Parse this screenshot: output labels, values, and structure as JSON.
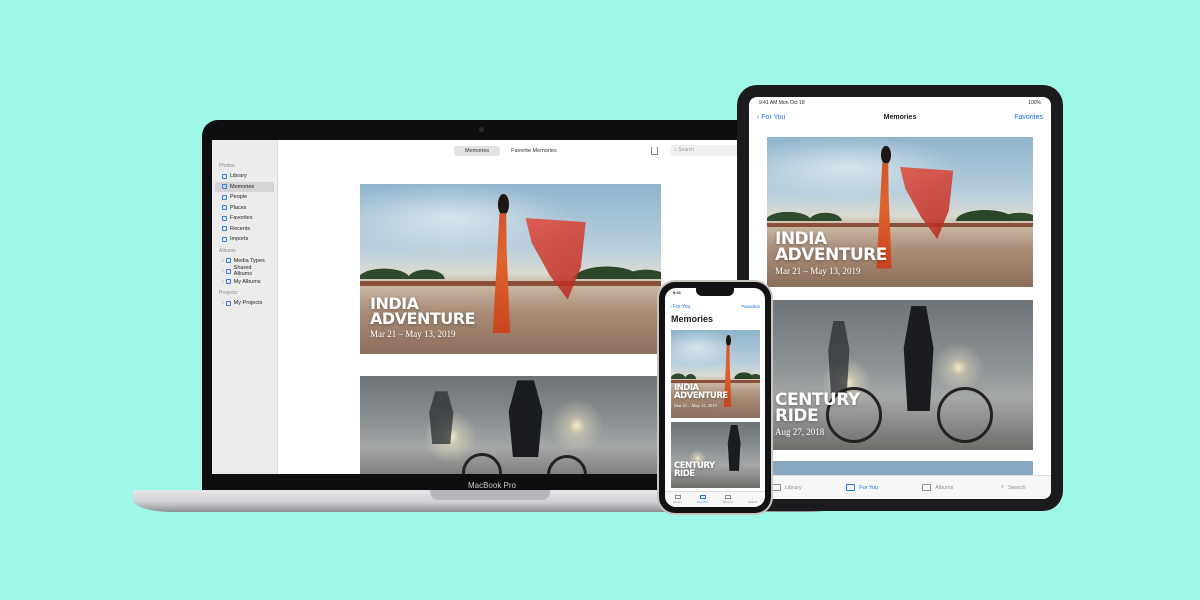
{
  "laptop": {
    "label": "MacBook Pro",
    "sidebar": {
      "sections": [
        {
          "title": "Photos",
          "items": [
            "Library",
            "Memories",
            "People",
            "Places",
            "Favorites",
            "Recents",
            "Imports"
          ]
        },
        {
          "title": "Albums",
          "items": [
            "Media Types",
            "Shared Albums",
            "My Albums"
          ]
        },
        {
          "title": "Projects",
          "items": [
            "My Projects"
          ]
        }
      ],
      "selected": "Memories"
    },
    "toolbar": {
      "tab_memories": "Memories",
      "tab_favorite_memories": "Favorite Memories",
      "search_placeholder": "Search"
    },
    "memories": [
      {
        "title_line1": "INDIA",
        "title_line2": "ADVENTURE",
        "date": "Mar 21 – May 13, 2019"
      }
    ]
  },
  "tablet": {
    "status": {
      "time": "9:41 AM",
      "date": "Mon Oct 18",
      "battery": "100%"
    },
    "nav": {
      "back": "For You",
      "title": "Memories",
      "right": "Favorites"
    },
    "memories": [
      {
        "title_line1": "INDIA",
        "title_line2": "ADVENTURE",
        "date": "Mar 21 – May 13, 2019"
      },
      {
        "title_line1": "CENTURY",
        "title_line2": "RIDE",
        "date": "Aug 27, 2018"
      }
    ],
    "tabs": [
      "Library",
      "For You",
      "Albums",
      "Search"
    ],
    "active_tab": "For You"
  },
  "phone": {
    "status": {
      "time": "9:41"
    },
    "nav": {
      "back": "For You",
      "right": "Favorites"
    },
    "title": "Memories",
    "memories": [
      {
        "title_line1": "INDIA",
        "title_line2": "ADVENTURE",
        "date": "Mar 21 – May 13, 2019"
      },
      {
        "title_line1": "CENTURY",
        "title_line2": "RIDE"
      }
    ],
    "tabs": [
      "Library",
      "For You",
      "Albums",
      "Search"
    ],
    "active_tab": "For You"
  },
  "colors": {
    "background": "#9ef7e7",
    "accent": "#1a73e8"
  }
}
